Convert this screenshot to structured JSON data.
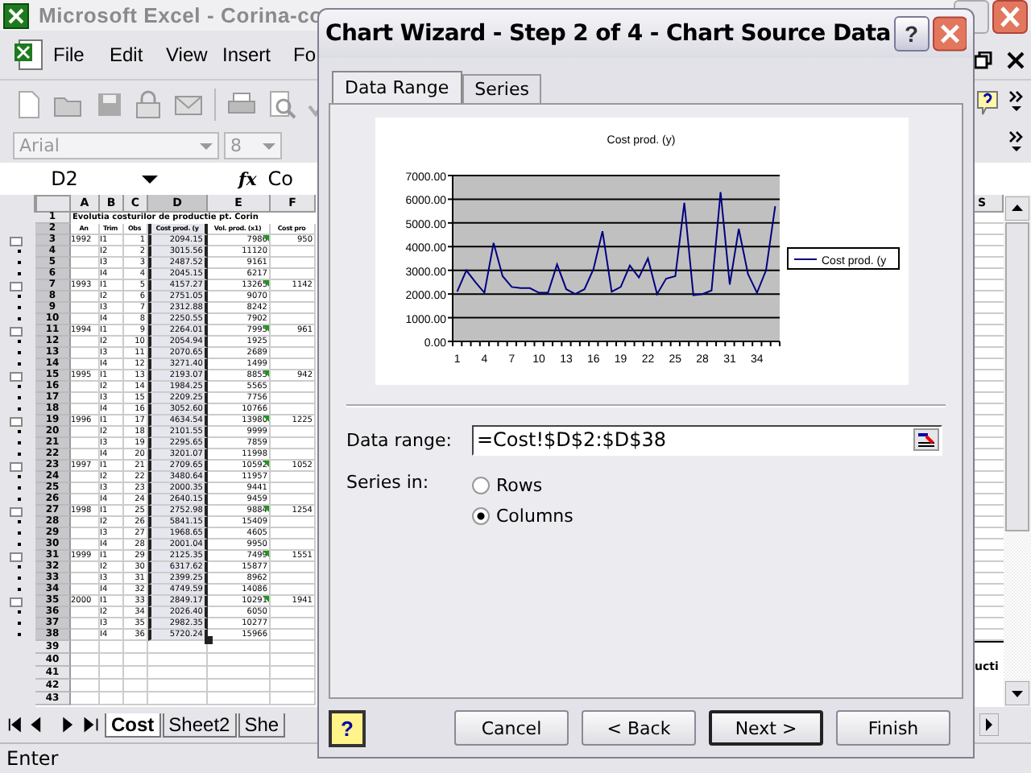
{
  "excel": {
    "title": "Microsoft Excel - Corina-co",
    "menu": [
      "File",
      "Edit",
      "View",
      "Insert",
      "Fo"
    ],
    "font_box": "Arial",
    "size_box": "8",
    "name_box": "D2",
    "fx": "fx",
    "formula": "Co",
    "columns": [
      "A",
      "B",
      "C",
      "D",
      "E",
      "F"
    ],
    "title_row": {
      "num": "1",
      "text": "Evolutia costurilor de productie pt. Corin"
    },
    "header_row": {
      "num": "2",
      "cells": [
        "An",
        "Trim",
        "Obs",
        "Cost prod. (y",
        "Vol. prod. (x1)",
        "Cost pro"
      ]
    },
    "rows": [
      {
        "num": "3",
        "cells": [
          "1992",
          "I1",
          "1",
          "2094.15",
          "7986",
          "950"
        ]
      },
      {
        "num": "4",
        "cells": [
          "",
          "I2",
          "2",
          "3015.56",
          "11120",
          ""
        ]
      },
      {
        "num": "5",
        "cells": [
          "",
          "I3",
          "3",
          "2487.52",
          "9161",
          ""
        ]
      },
      {
        "num": "6",
        "cells": [
          "",
          "I4",
          "4",
          "2045.15",
          "6217",
          ""
        ]
      },
      {
        "num": "7",
        "cells": [
          "1993",
          "I1",
          "5",
          "4157.27",
          "13265",
          "1142"
        ]
      },
      {
        "num": "8",
        "cells": [
          "",
          "I2",
          "6",
          "2751.05",
          "9070",
          ""
        ]
      },
      {
        "num": "9",
        "cells": [
          "",
          "I3",
          "7",
          "2312.88",
          "8242",
          ""
        ]
      },
      {
        "num": "10",
        "cells": [
          "",
          "I4",
          "8",
          "2250.55",
          "7902",
          ""
        ]
      },
      {
        "num": "11",
        "cells": [
          "1994",
          "I1",
          "9",
          "2264.01",
          "7995",
          "961"
        ]
      },
      {
        "num": "12",
        "cells": [
          "",
          "I2",
          "10",
          "2054.94",
          "1925",
          ""
        ]
      },
      {
        "num": "13",
        "cells": [
          "",
          "I3",
          "11",
          "2070.65",
          "2689",
          ""
        ]
      },
      {
        "num": "14",
        "cells": [
          "",
          "I4",
          "12",
          "3271.40",
          "1499",
          ""
        ]
      },
      {
        "num": "15",
        "cells": [
          "1995",
          "I1",
          "13",
          "2193.07",
          "8855",
          "942"
        ]
      },
      {
        "num": "16",
        "cells": [
          "",
          "I2",
          "14",
          "1984.25",
          "5565",
          ""
        ]
      },
      {
        "num": "17",
        "cells": [
          "",
          "I3",
          "15",
          "2209.25",
          "7756",
          ""
        ]
      },
      {
        "num": "18",
        "cells": [
          "",
          "I4",
          "16",
          "3052.60",
          "10766",
          ""
        ]
      },
      {
        "num": "19",
        "cells": [
          "1996",
          "I1",
          "17",
          "4634.54",
          "13980",
          "1225"
        ]
      },
      {
        "num": "20",
        "cells": [
          "",
          "I2",
          "18",
          "2101.55",
          "9999",
          ""
        ]
      },
      {
        "num": "21",
        "cells": [
          "",
          "I3",
          "19",
          "2295.65",
          "7859",
          ""
        ]
      },
      {
        "num": "22",
        "cells": [
          "",
          "I4",
          "20",
          "3201.07",
          "11998",
          ""
        ]
      },
      {
        "num": "23",
        "cells": [
          "1997",
          "I1",
          "21",
          "2709.65",
          "10592",
          "1052"
        ]
      },
      {
        "num": "24",
        "cells": [
          "",
          "I2",
          "22",
          "3480.64",
          "11957",
          ""
        ]
      },
      {
        "num": "25",
        "cells": [
          "",
          "I3",
          "23",
          "2000.35",
          "9441",
          ""
        ]
      },
      {
        "num": "26",
        "cells": [
          "",
          "I4",
          "24",
          "2640.15",
          "9459",
          ""
        ]
      },
      {
        "num": "27",
        "cells": [
          "1998",
          "I1",
          "25",
          "2752.98",
          "9884",
          "1254"
        ]
      },
      {
        "num": "28",
        "cells": [
          "",
          "I2",
          "26",
          "5841.15",
          "15409",
          ""
        ]
      },
      {
        "num": "29",
        "cells": [
          "",
          "I3",
          "27",
          "1968.65",
          "4605",
          ""
        ]
      },
      {
        "num": "30",
        "cells": [
          "",
          "I4",
          "28",
          "2001.04",
          "9950",
          ""
        ]
      },
      {
        "num": "31",
        "cells": [
          "1999",
          "I1",
          "29",
          "2125.35",
          "7499",
          "1551"
        ]
      },
      {
        "num": "32",
        "cells": [
          "",
          "I2",
          "30",
          "6317.62",
          "15877",
          ""
        ]
      },
      {
        "num": "33",
        "cells": [
          "",
          "I3",
          "31",
          "2399.25",
          "8962",
          ""
        ]
      },
      {
        "num": "34",
        "cells": [
          "",
          "I4",
          "32",
          "4749.59",
          "14086",
          ""
        ]
      },
      {
        "num": "35",
        "cells": [
          "2000",
          "I1",
          "33",
          "2849.17",
          "10291",
          "1941"
        ]
      },
      {
        "num": "36",
        "cells": [
          "",
          "I2",
          "34",
          "2026.40",
          "6050",
          ""
        ]
      },
      {
        "num": "37",
        "cells": [
          "",
          "I3",
          "35",
          "2982.35",
          "10277",
          ""
        ]
      },
      {
        "num": "38",
        "cells": [
          "",
          "I4",
          "36",
          "5720.24",
          "15966",
          ""
        ]
      }
    ],
    "empty_rows": [
      "39",
      "40",
      "41",
      "42",
      "43"
    ],
    "right_column": "S",
    "right_text": "ucti",
    "sheet_tabs": [
      {
        "label": "Cost",
        "selected": true
      },
      {
        "label": "Sheet2",
        "selected": false
      },
      {
        "label": "She",
        "selected": false
      }
    ],
    "status": "Enter"
  },
  "dialog": {
    "title": "Chart Wizard - Step 2 of 4 - Chart Source Data",
    "help_glyph": "?",
    "tabs": [
      {
        "label": "Data Range",
        "selected": true
      },
      {
        "label": "Series",
        "selected": false
      }
    ],
    "chart_data": {
      "type": "line",
      "title": "Cost prod. (y)",
      "grid": true,
      "x": [
        1,
        2,
        3,
        4,
        5,
        6,
        7,
        8,
        9,
        10,
        11,
        12,
        13,
        14,
        15,
        16,
        17,
        18,
        19,
        20,
        21,
        22,
        23,
        24,
        25,
        26,
        27,
        28,
        29,
        30,
        31,
        32,
        33,
        34,
        35,
        36
      ],
      "series": [
        {
          "name": "Cost prod. (y",
          "color": "#000080",
          "values": [
            2100,
            3000,
            2500,
            2050,
            4150,
            2750,
            2300,
            2250,
            2250,
            2050,
            2050,
            3250,
            2200,
            2000,
            2200,
            3050,
            4650,
            2100,
            2300,
            3200,
            2700,
            3500,
            2000,
            2650,
            2750,
            5850,
            1950,
            2000,
            2150,
            6300,
            2400,
            4750,
            2850,
            2050,
            3000,
            5700
          ]
        }
      ],
      "xlim": [
        0.5,
        36.5
      ],
      "ylim": [
        0,
        7000
      ],
      "yticks": [
        {
          "value": 0,
          "label": "0.00"
        },
        {
          "value": 1000,
          "label": "1000.00"
        },
        {
          "value": 2000,
          "label": "2000.00"
        },
        {
          "value": 3000,
          "label": "3000.00"
        },
        {
          "value": 4000,
          "label": "4000.00"
        },
        {
          "value": 5000,
          "label": "5000.00"
        },
        {
          "value": 6000,
          "label": "6000.00"
        },
        {
          "value": 7000,
          "label": "7000.00"
        }
      ],
      "xticks": [
        1,
        4,
        7,
        10,
        13,
        16,
        19,
        22,
        25,
        28,
        31,
        34
      ]
    },
    "range_label": "Data range:",
    "range_value": "=Cost!$D$2:$D$38",
    "series_in_label": "Series in:",
    "series_in": [
      {
        "label": "Rows",
        "selected": false
      },
      {
        "label": "Columns",
        "selected": true
      }
    ],
    "buttons": [
      {
        "label": "Cancel",
        "default": false
      },
      {
        "label": "< Back",
        "default": false
      },
      {
        "label": "Next >",
        "default": true
      },
      {
        "label": "Finish",
        "default": false
      }
    ]
  }
}
